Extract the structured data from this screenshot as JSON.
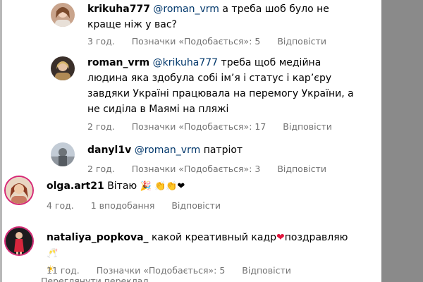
{
  "comments": [
    {
      "username": "krikuha777",
      "mention": "@roman_vrm",
      "text_line1": "а треба шоб було не",
      "text_line2": "краще ніж у вас?",
      "time": "3 год.",
      "likes": "Позначки «Подобається»: 5",
      "reply": "Відповісти"
    },
    {
      "username": "roman_vrm",
      "mention": "@krikuha777",
      "text_line1": "треба щоб медійна",
      "text_line2": "людина яка здобула собі ім’я і статус і кар’єру",
      "text_line3": "завдяки Україні працювала на перемогу України, а",
      "text_line4": "не сиділа в Маямі на пляжі",
      "time": "2 год.",
      "likes": "Позначки «Подобається»: 17",
      "reply": "Відповісти"
    },
    {
      "username": "danyl1v",
      "mention": "@roman_vrm",
      "text_line1": "патріот",
      "time": "2 год.",
      "likes": "Позначки «Подобається»: 3",
      "reply": "Відповісти"
    },
    {
      "username": "olga.art21",
      "text_line1": "Вітаю",
      "emojis": "🎉 👏👏❤",
      "time": "4 год.",
      "likes": "1 вподобання",
      "reply": "Відповісти"
    },
    {
      "username": "nataliya_popkova_",
      "text_line1": "какой креативный кадр",
      "heart": "❤",
      "text_line1b": "поздравляю",
      "emoji_end": "🥂",
      "line2_emoji": "☀",
      "time": "11 год.",
      "likes": "Позначки «Подобається»: 5",
      "reply": "Відповісти"
    }
  ],
  "cut_text": "Переглянути переклад",
  "colors": {
    "mention": "#00376b",
    "meta": "#737373",
    "heart": "#e0163d",
    "right_panel": "#8a8a8a"
  }
}
